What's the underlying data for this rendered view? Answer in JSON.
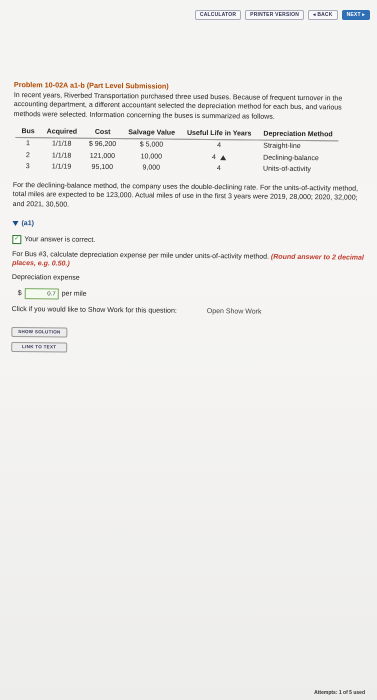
{
  "topbar": {
    "calculator": "CALCULATOR",
    "printer": "PRINTER VERSION",
    "back": "◂ BACK",
    "next": "NEXT ▸"
  },
  "problem": {
    "title": "Problem 10-02A a1-b (Part Level Submission)",
    "intro": "In recent years, Riverbed Transportation purchased three used buses. Because of frequent turnover in the accounting department, a different accountant selected the depreciation method for each bus, and various methods were selected. Information concerning the buses is summarized as follows."
  },
  "table": {
    "headers": [
      "Bus",
      "Acquired",
      "Cost",
      "Salvage Value",
      "Useful Life in Years",
      "Depreciation Method"
    ],
    "rows": [
      [
        "1",
        "1/1/18",
        "$ 96,200",
        "$ 5,000",
        "4",
        "Straight-line"
      ],
      [
        "2",
        "1/1/18",
        "121,000",
        "10,000",
        "4",
        "Declining-balance"
      ],
      [
        "3",
        "1/1/19",
        "95,100",
        "9,000",
        "4",
        "Units-of-activity"
      ]
    ]
  },
  "para2": "For the declining-balance method, the company uses the double-declining rate. For the units-of-activity method, total miles are expected to be 123,000. Actual miles of use in the first 3 years were 2019, 28,000; 2020, 32,000; and 2021, 30,500.",
  "part_a": {
    "label": "(a1)",
    "correct_text": "Your answer is correct.",
    "question": "For Bus #3, calculate depreciation expense per mile under units-of-activity method.",
    "hint": "(Round answer to 2 decimal places, e.g. 0.50.)",
    "field_label": "Depreciation expense",
    "currency": "$",
    "value": "0.7",
    "unit": "per mile"
  },
  "work": {
    "prompt": "Click if you would like to Show Work for this question:",
    "link": "Open Show Work"
  },
  "buttons": {
    "show_solution": "SHOW SOLUTION",
    "link_to_text": "LINK TO TEXT"
  },
  "footer": {
    "attempts": "Attempts: 1 of 5 used"
  }
}
